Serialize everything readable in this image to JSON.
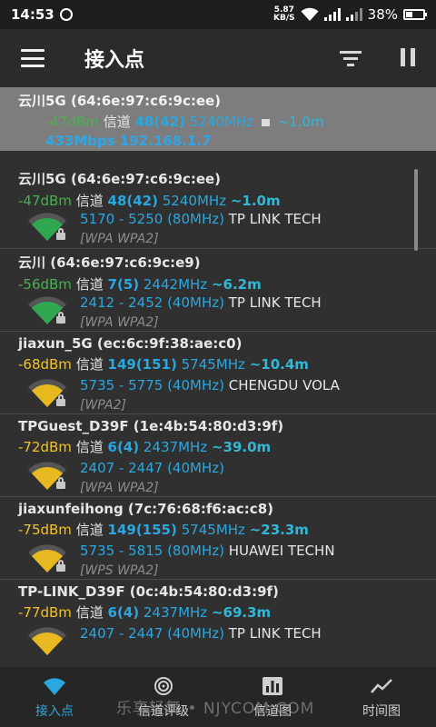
{
  "status": {
    "time": "14:53",
    "speed_value": "5.87",
    "speed_unit": "KB/S",
    "battery": "38%",
    "battery_level": 0.38
  },
  "appbar": {
    "title": "接入点"
  },
  "connected": {
    "ssid": "云川5G (64:6e:97:c6:9c:ee)",
    "dbm": "-47dBm",
    "channel_label": "信道",
    "channel": "48(42)",
    "freq": "5240MHz",
    "distance": "~1.0m",
    "rate": "433Mbps",
    "ip": "192.168.1.7"
  },
  "access_points": [
    {
      "ssid": "云川5G (64:6e:97:c6:9c:ee)",
      "dbm": "-47dBm",
      "channel_label": "信道",
      "channel": "48(42)",
      "freq": "5240MHz",
      "distance": "~1.0m",
      "range": "5170 - 5250 (80MHz)",
      "vendor": "TP LINK TECH",
      "security": "[WPA WPA2]",
      "color": "#2fa84f",
      "level": "green",
      "locked": true
    },
    {
      "ssid": "云川 (64:6e:97:c6:9c:e9)",
      "dbm": "-56dBm",
      "channel_label": "信道",
      "channel": "7(5)",
      "freq": "2442MHz",
      "distance": "~6.2m",
      "range": "2412 - 2452 (40MHz)",
      "vendor": "TP LINK TECH",
      "security": "[WPA WPA2]",
      "color": "#2fa84f",
      "level": "green",
      "locked": true
    },
    {
      "ssid": "jiaxun_5G (ec:6c:9f:38:ae:c0)",
      "dbm": "-68dBm",
      "channel_label": "信道",
      "channel": "149(151)",
      "freq": "5745MHz",
      "distance": "~10.4m",
      "range": "5735 - 5775 (40MHz)",
      "vendor": "CHENGDU VOLA",
      "security": "[WPA2]",
      "color": "#e8b820",
      "level": "yellow",
      "locked": true
    },
    {
      "ssid": "TPGuest_D39F (1e:4b:54:80:d3:9f)",
      "dbm": "-72dBm",
      "channel_label": "信道",
      "channel": "6(4)",
      "freq": "2437MHz",
      "distance": "~39.0m",
      "range": "2407 - 2447 (40MHz)",
      "vendor": "",
      "security": "[WPA WPA2]",
      "color": "#e8b820",
      "level": "yellow",
      "locked": true
    },
    {
      "ssid": "jiaxunfeihong (7c:76:68:f6:ac:c8)",
      "dbm": "-75dBm",
      "channel_label": "信道",
      "channel": "149(155)",
      "freq": "5745MHz",
      "distance": "~23.3m",
      "range": "5735 - 5815 (80MHz)",
      "vendor": "HUAWEI TECHN",
      "security": "[WPS WPA2]",
      "color": "#e8b820",
      "level": "yellow",
      "locked": true
    },
    {
      "ssid": "TP-LINK_D39F (0c:4b:54:80:d3:9f)",
      "dbm": "-77dBm",
      "channel_label": "信道",
      "channel": "6(4)",
      "freq": "2437MHz",
      "distance": "~69.3m",
      "range": "2407 - 2447 (40MHz)",
      "vendor": "TP LINK TECH",
      "security": "",
      "color": "#e8b820",
      "level": "yellow",
      "locked": false
    }
  ],
  "nav": [
    {
      "label": "接入点",
      "icon": "wifi-icon",
      "active": true
    },
    {
      "label": "信道评级",
      "icon": "channel-rating-icon",
      "active": false
    },
    {
      "label": "信道图",
      "icon": "channel-graph-icon",
      "active": false
    },
    {
      "label": "时间图",
      "icon": "time-graph-icon",
      "active": false
    }
  ],
  "watermark": "乐享轻舞 • NJYCOM.COM",
  "colors": {
    "green_level": "#2fa84f",
    "yellow_level": "#e8b820",
    "accent": "#2aa7e0"
  }
}
